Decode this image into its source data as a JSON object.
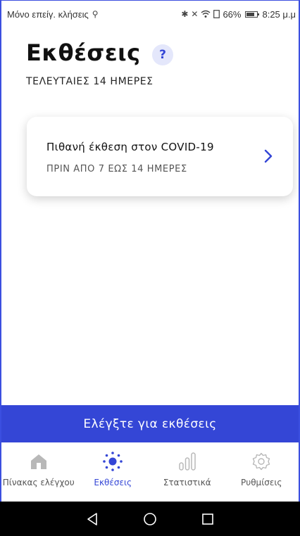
{
  "status_bar": {
    "carrier_text": "Μόνο επείγ. κλήσεις",
    "battery_percent": "66%",
    "time": "8:25 μ.μ"
  },
  "header": {
    "title": "Εκθέσεις",
    "help_label": "?",
    "subtitle": "ΤΕΛΕΥΤΑΙΕΣ 14 ΗΜΕΡΕΣ"
  },
  "exposure_card": {
    "title": "Πιθανή έκθεση στον COVID-19",
    "subtitle": "ΠΡΙΝ ΑΠΟ 7 ΕΩΣ 14 ΗΜΕΡΕΣ",
    "icon": "chevron-right-icon"
  },
  "check_button": {
    "label": "Ελέγξτε για εκθέσεις"
  },
  "bottom_nav": {
    "items": [
      {
        "label": "Πίνακας ελέγχου",
        "icon": "home-icon",
        "active": false
      },
      {
        "label": "Εκθέσεις",
        "icon": "exposure-dots-icon",
        "active": true
      },
      {
        "label": "Στατιστικά",
        "icon": "bar-chart-icon",
        "active": false
      },
      {
        "label": "Ρυθμίσεις",
        "icon": "gear-icon",
        "active": false
      }
    ]
  },
  "android_nav": {
    "buttons": [
      "back-icon",
      "home-circle-icon",
      "recents-icon"
    ]
  },
  "colors": {
    "accent": "#3446d6",
    "help_bg": "#e4e7fb",
    "inactive_icon": "#b8b8b8"
  }
}
